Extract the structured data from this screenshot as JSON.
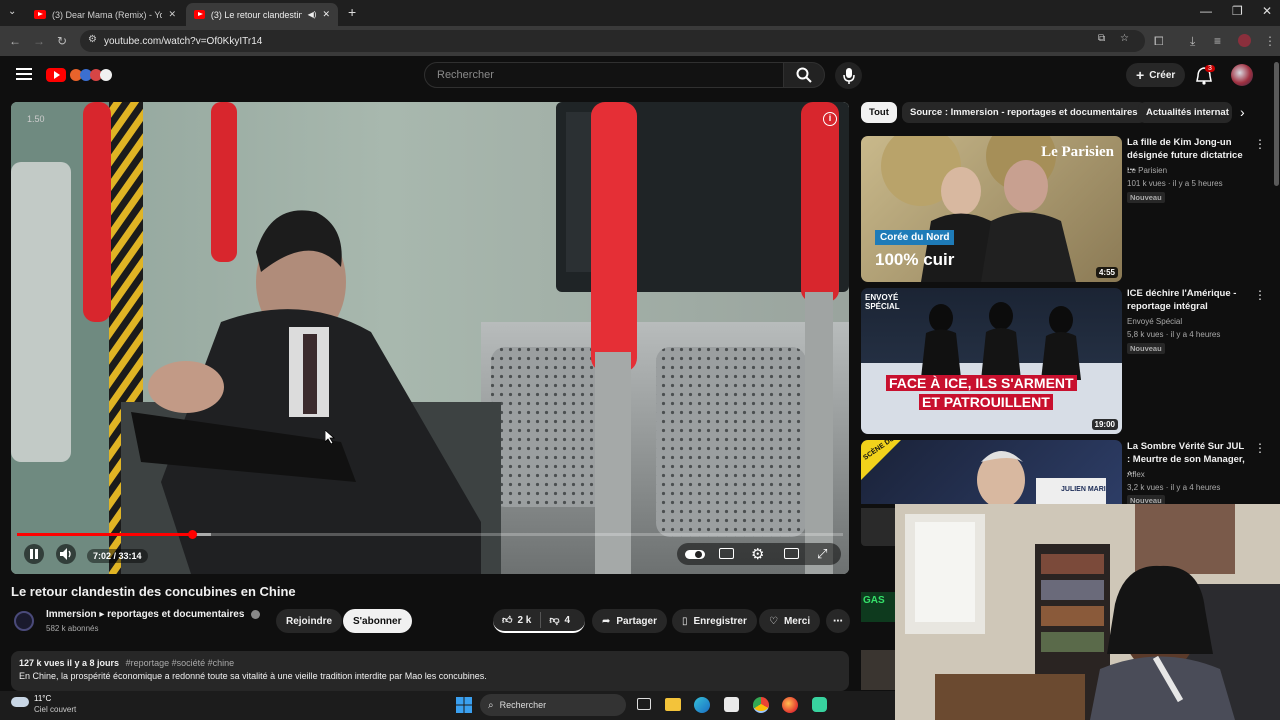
{
  "browser": {
    "tabs": [
      {
        "title": "(3) Dear Mama (Remix) - YouTube",
        "active": false
      },
      {
        "title": "(3) Le retour clandestin des concubines en Chine",
        "active": true
      }
    ],
    "new_tab_symbol": "+",
    "url": "youtube.com/watch?v=Of0KkyITr14"
  },
  "youtube": {
    "search_placeholder": "Rechercher",
    "create_label": "Créer",
    "notification_count": "3"
  },
  "player": {
    "speed_overlay": "1.50",
    "time": "7:02 / 33:14",
    "progress_fraction": 0.2117,
    "buffered_fraction": 0.235
  },
  "video": {
    "title": "Le retour clandestin des concubines en Chine",
    "channel": "Immersion ▸ reportages et documentaires",
    "subscribers": "582 k abonnés",
    "join_label": "Rejoindre",
    "subscribe_label": "S'abonner",
    "likes": "2 k",
    "dislikes": "4",
    "share_label": "Partager",
    "save_label": "Enregistrer",
    "thanks_label": "Merci",
    "desc_stats": "127 k vues  il y a 8 jours",
    "desc_tags": "#reportage #société #chine",
    "desc_line1": "En Chine, la prospérité économique a redonné toute sa vitalité à une vieille tradition interdite par Mao  les concubines."
  },
  "chips": [
    "Tout",
    "Source : Immersion - reportages et documentaires",
    "Actualités internat"
  ],
  "recommendations": [
    {
      "title": "La fille de Kim Jong-un désignée future dictatrice ...",
      "channel": "Le Parisien",
      "meta": "101 k vues · il y a 5 heures",
      "badge": "Nouveau",
      "duration": "4:55",
      "thumb_brand": "Le Parisien",
      "thumb_tag": "Corée du Nord",
      "thumb_caption": "100% cuir"
    },
    {
      "title": "ICE déchire l'Amérique - reportage intégral",
      "channel": "Envoyé Spécial",
      "meta": "5,8 k vues · il y a 4 heures",
      "badge": "Nouveau",
      "duration": "19:00",
      "thumb_brand": "ENVOYÉ SPÉCIAL",
      "thumb_caption1": "FACE À ICE, ILS S'ARMENT",
      "thumb_caption2": "ET PATROUILLENT"
    },
    {
      "title": "La Sombre Vérité Sur JUL : Meurtre de son Manager, ...",
      "channel": "Aflex",
      "meta": "3,2 k vues · il y a 4 heures",
      "badge": "Nouveau",
      "thumb_tag": "SCÈNE DU",
      "thumb_caption": "JULIEN MARI"
    }
  ],
  "sidebar_partial_label": "GAS",
  "taskbar": {
    "temperature": "11°C",
    "weather": "Ciel couvert",
    "search_label": "Rechercher"
  },
  "colors": {
    "yt_red": "#ff0000",
    "background": "#0f0f0f",
    "subscribe_bg": "#f1f1f1",
    "ice_red": "#c8102e"
  }
}
